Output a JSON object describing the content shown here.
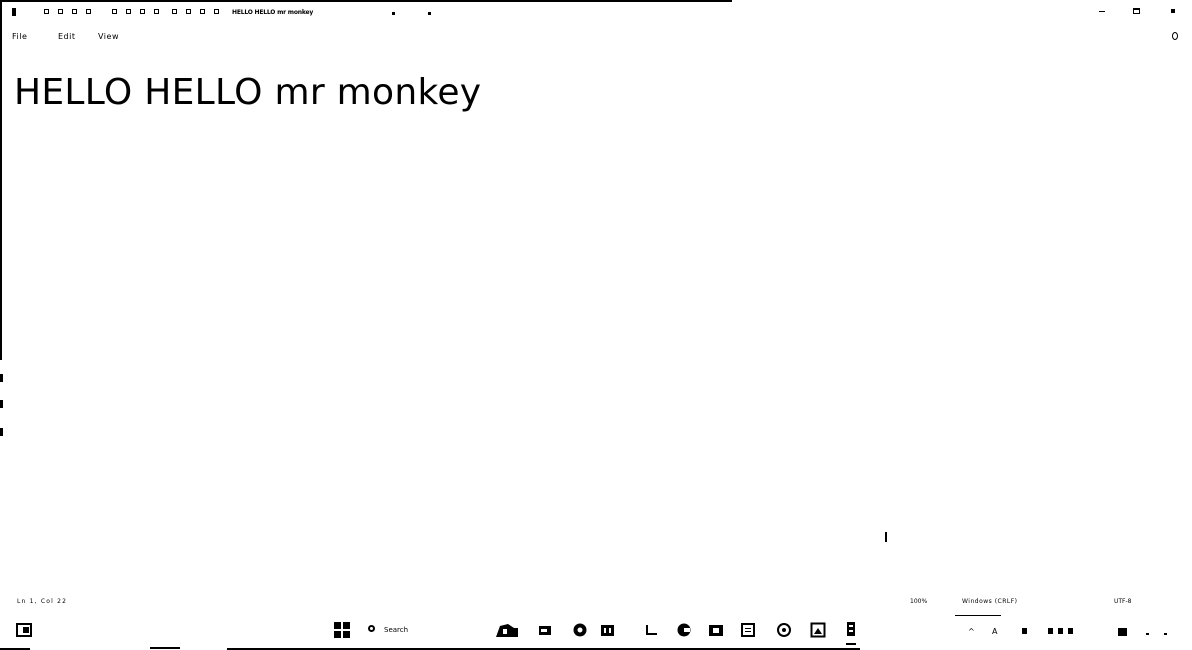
{
  "window": {
    "title": "HELLO HELLO mr monkey"
  },
  "menu": {
    "items": [
      "File",
      "Edit",
      "View"
    ]
  },
  "editor": {
    "content": "HELLO HELLO mr monkey"
  },
  "statusbar": {
    "position": "Ln 1, Col 22",
    "zoom": "100%",
    "line_ending": "Windows (CRLF)",
    "encoding": "UTF-8"
  },
  "taskbar": {
    "search_placeholder": "Search",
    "apps": [
      "cloud-drive-icon",
      "file-explorer-icon",
      "chrome-icon",
      "store-icon",
      "folder-icon",
      "edge-icon",
      "teams-icon",
      "notepad-icon",
      "media-player-icon",
      "photos-icon",
      "terminal-icon"
    ],
    "tray": {
      "overflow_label": "^",
      "language": "A"
    }
  }
}
